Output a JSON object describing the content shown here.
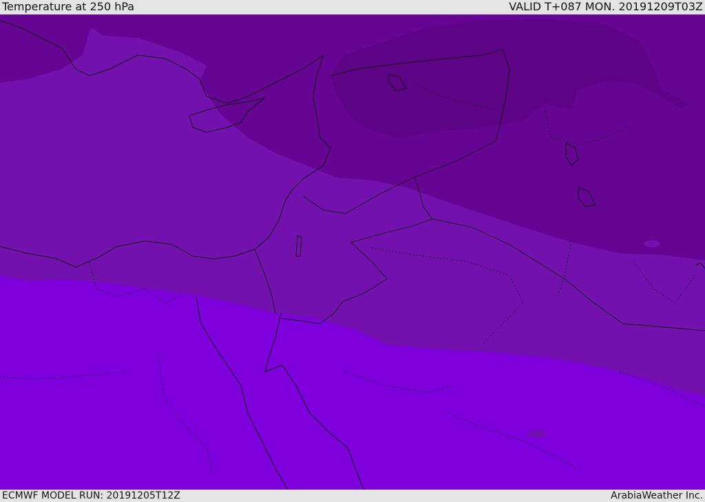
{
  "header": {
    "title": "Temperature at 250 hPa",
    "valid_time": "VALID T+087 MON. 20191209T03Z"
  },
  "footer": {
    "model_run": "ECMWF MODEL RUN: 20191205T12Z",
    "credit": "ArabiaWeather Inc."
  },
  "map": {
    "band_colors": [
      "#5d0385",
      "#660493",
      "#7211ae",
      "#7d00dd"
    ]
  }
}
